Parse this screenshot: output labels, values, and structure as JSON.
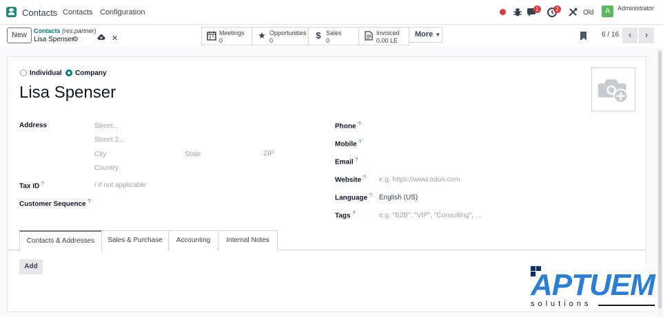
{
  "navbar": {
    "app_name": "Contacts",
    "menu": [
      "Contacts",
      "Configuration"
    ],
    "chat_badge": "1",
    "activity_badge": "2",
    "old_label": "Old",
    "avatar_letter": "A",
    "user": "Administrator"
  },
  "control": {
    "new_label": "New",
    "breadcrumb_link": "Contacts",
    "breadcrumb_model": "(res.partner)",
    "record_name": "Lisa Spenser",
    "smart_buttons": [
      {
        "label": "Meetings",
        "value": "0",
        "icon": "calendar-icon"
      },
      {
        "label": "Opportunities",
        "value": "0",
        "icon": "star-icon"
      },
      {
        "label": "Sales",
        "value": "0",
        "icon": "dollar-icon"
      },
      {
        "label": "Invoiced",
        "value": "0.00 LE",
        "icon": "invoice-icon"
      }
    ],
    "more_label": "More",
    "pager": "6 / 16"
  },
  "form": {
    "type_options": [
      "Individual",
      "Company"
    ],
    "selected_type": "Company",
    "name": "Lisa Spenser",
    "address_label": "Address",
    "street_ph": "Street...",
    "street2_ph": "Street 2...",
    "city_ph": "City",
    "state_ph": "State",
    "zip_ph": "ZIP",
    "country_ph": "Country",
    "taxid_label": "Tax ID",
    "taxid_ph": "/ if not applicable",
    "custseq_label": "Customer Sequence",
    "phone_label": "Phone",
    "mobile_label": "Mobile",
    "email_label": "Email",
    "website_label": "Website",
    "website_ph": "e.g. https://www.odoo.com",
    "language_label": "Language",
    "language_value": "English (US)",
    "tags_label": "Tags",
    "tags_ph": "e.g. \"B2B\", \"VIP\", \"Consulting\", ...",
    "help_mark": "?"
  },
  "tabs": {
    "items": [
      "Contacts & Addresses",
      "Sales & Purchase",
      "Accounting",
      "Internal Notes"
    ],
    "active": "Contacts & Addresses"
  },
  "add_label": "Add",
  "logo": {
    "text": "APTUEM",
    "sub": "solutions"
  },
  "colors": {
    "accent": "#017e84",
    "badge": "#d83b3b",
    "avatar": "#5cb85c",
    "logo_blue": "#2a7fd4"
  }
}
